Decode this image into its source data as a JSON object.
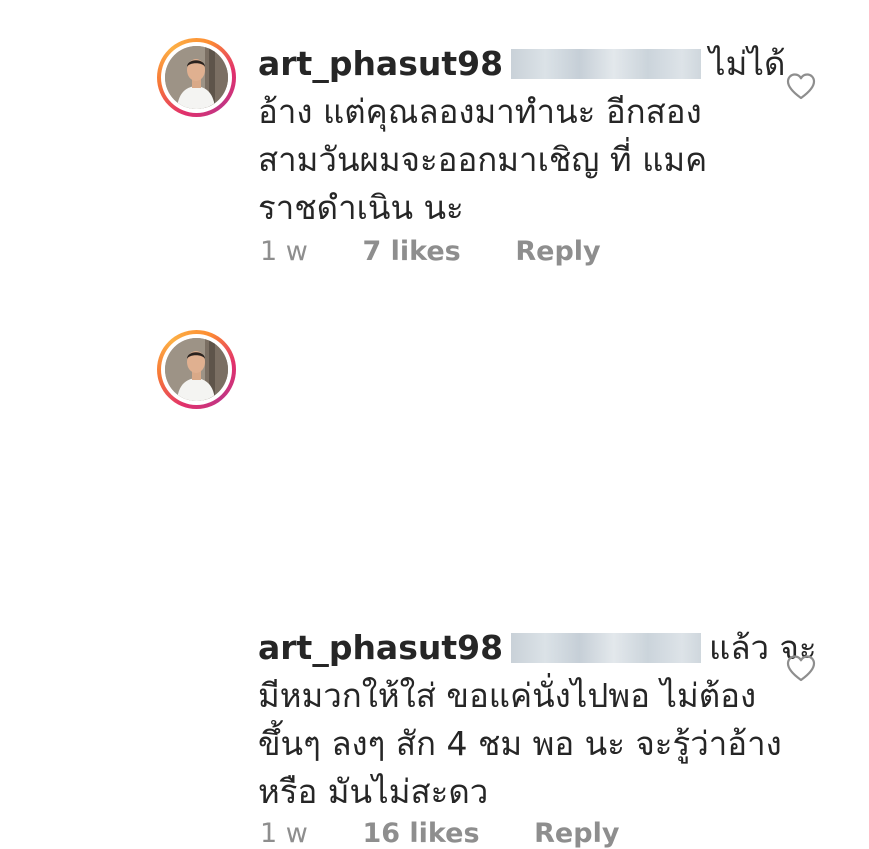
{
  "comments": [
    {
      "username": "art_phasut98",
      "text_lines": [
        "ไม่ได้",
        "อ้าง แต่คุณลองมาทำนะ อีกสอง",
        "สามวันผมจะออกมาเชิญ ที่ แมค",
        "ราชดำเนิน นะ"
      ],
      "time": "1 w",
      "likes": "7 likes",
      "reply": "Reply",
      "icons": {
        "avatar": "profile-photo",
        "like": "heart-outline-icon"
      }
    },
    {
      "username": "art_phasut98",
      "text_lines": [
        "แล้ว จะ",
        "มีหมวกให้ใส่ ขอแค่นั่งไปพอ ไม่ต้อง",
        "ขึ้นๆ ลงๆ สัก 4 ชม พอ นะ จะรู้ว่าอ้าง",
        "หรือ มันไม่สะดว"
      ],
      "time": "1 w",
      "likes": "16 likes",
      "reply": "Reply",
      "icons": {
        "avatar": "profile-photo",
        "like": "heart-outline-icon"
      }
    }
  ],
  "colors": {
    "text": "#262626",
    "meta": "#8e8e8e",
    "story_ring": [
      "#e1306c",
      "#f77737",
      "#fcaf45",
      "#c13584"
    ],
    "redaction": "#cfd7dd"
  }
}
